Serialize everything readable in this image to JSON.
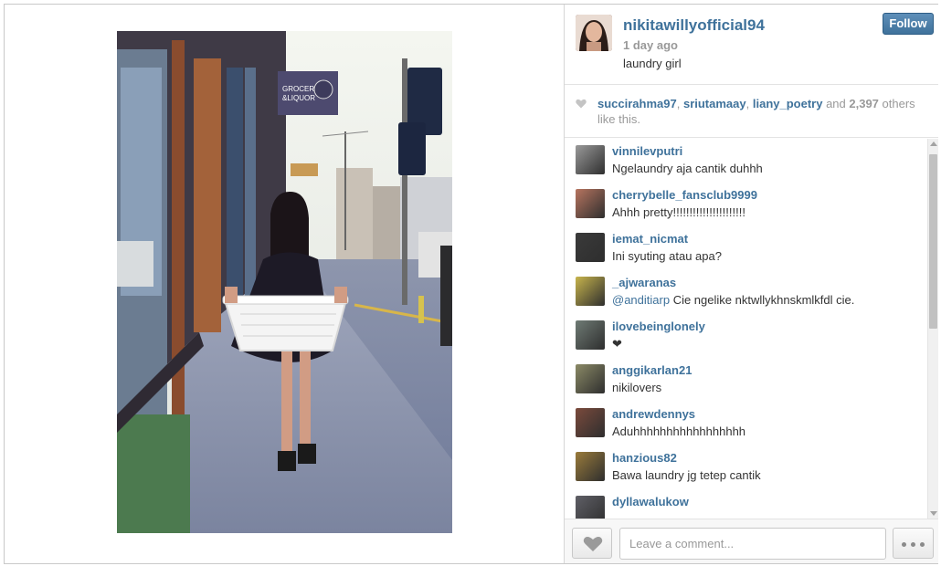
{
  "post": {
    "username": "nikitawillyofficial94",
    "time": "1 day ago",
    "caption": "laundry girl ",
    "follow_label": "Follow",
    "photo_signs": {
      "grocery_line1": "GROCERY",
      "grocery_line2": "&LIQUOR"
    }
  },
  "likes": {
    "users": [
      "succirahma97",
      "sriutamaay",
      "liany_poetry"
    ],
    "sep": ", ",
    "and": " and ",
    "count": "2,397",
    "suffix_1": " others",
    "suffix_2": "like this."
  },
  "comments": [
    {
      "user": "vinnilevputri",
      "text": "Ngelaundry aja cantik duhhh",
      "avatar_color": "#9a9a9a"
    },
    {
      "user": "cherrybelle_fansclub9999",
      "text": "Ahhh pretty!!!!!!!!!!!!!!!!!!!!!!",
      "avatar_color": "#b7745f"
    },
    {
      "user": "iemat_nicmat",
      "text": "Ini syuting atau apa?",
      "avatar_color": "#3a3a3a"
    },
    {
      "user": "_ajwaranas",
      "mention": "@anditiarp",
      "text": " Cie ngelike nktwllykhnskmlkfdl cie.",
      "avatar_color": "#c7b44c"
    },
    {
      "user": "ilovebeinglonely",
      "text": "❤",
      "avatar_color": "#6f7b75"
    },
    {
      "user": "anggikarlan21",
      "text": "nikilovers",
      "avatar_color": "#8b8a66"
    },
    {
      "user": "andrewdennys",
      "text": "Aduhhhhhhhhhhhhhhhhh",
      "avatar_color": "#7a4a3c"
    },
    {
      "user": "hanzious82",
      "text": "Bawa laundry jg tetep cantik ",
      "avatar_color": "#9a7b3b"
    },
    {
      "user": "dyllawalukow",
      "text": "",
      "avatar_color": "#5f5f66"
    }
  ],
  "composer": {
    "placeholder": "Leave a comment..."
  },
  "colors": {
    "link": "#3f729b",
    "muted": "#999999",
    "follow_button": "#3f729b"
  },
  "icons": {
    "like": "heart-icon",
    "more": "ellipsis-icon"
  }
}
